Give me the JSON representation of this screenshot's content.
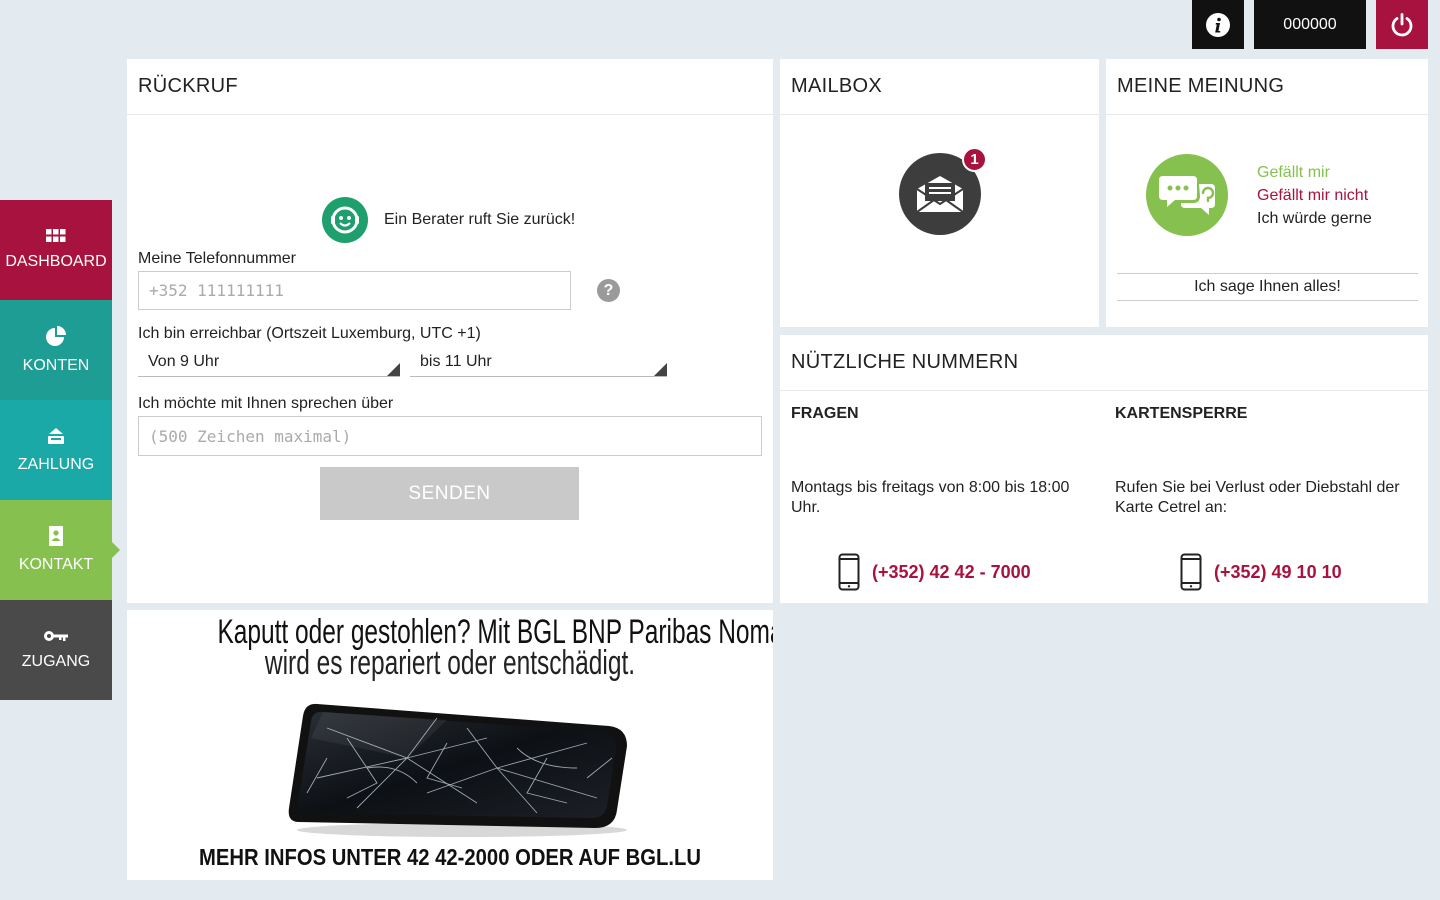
{
  "topbar": {
    "account_number": "000000"
  },
  "sidebar": {
    "items": [
      {
        "label": "DASHBOARD",
        "icon": "grid-icon",
        "color": "#a8123e"
      },
      {
        "label": "KONTEN",
        "icon": "pie-chart-icon",
        "color": "#1d9d94"
      },
      {
        "label": "ZAHLUNG",
        "icon": "payment-icon",
        "color": "#1aa9a6"
      },
      {
        "label": "KONTAKT",
        "icon": "contact-book-icon",
        "color": "#86c04e",
        "active": true
      },
      {
        "label": "ZUGANG",
        "icon": "key-icon",
        "color": "#4a4a4a"
      }
    ]
  },
  "rueckruf": {
    "title": "RÜCKRUF",
    "advisor_text": "Ein Berater ruft Sie zurück!",
    "phone_label": "Meine Telefonnummer",
    "phone_placeholder": "+352 111111111",
    "reachable_label": "Ich bin erreichbar (Ortszeit Luxemburg, UTC +1)",
    "from_select": "Von 9 Uhr",
    "to_select": "bis 11 Uhr",
    "topic_label": "Ich möchte mit Ihnen sprechen über",
    "topic_placeholder": "(500 Zeichen maximal)",
    "send_label": "SENDEN"
  },
  "mailbox": {
    "title": "MAILBOX",
    "unread_count": "1"
  },
  "meinung": {
    "title": "MEINE MEINUNG",
    "like": "Gefällt mir",
    "dislike": "Gefällt mir nicht",
    "wish": "Ich würde gerne",
    "tell_all": "Ich sage Ihnen alles!"
  },
  "nummern": {
    "title": "NÜTZLICHE NUMMERN",
    "fragen": {
      "title": "FRAGEN",
      "text": "Montags bis freitags von 8:00 bis 18:00 Uhr.",
      "phone": "(+352) 42 42 - 7000"
    },
    "kartensperre": {
      "title": "KARTENSPERRE",
      "text": "Rufen Sie bei Verlust oder Diebstahl der Karte Cetrel an:",
      "phone": "(+352) 49 10 10"
    }
  },
  "ad": {
    "line1_bold": "Kaputt oder gestohlen?",
    "line1_rest": "Mit",
    "line1_brand": "BGL BNP Paribas Nomad",
    "line2": "wird es repariert oder entschädigt.",
    "footer": "MEHR INFOS UNTER 42 42-2000 ODER AUF BGL.LU"
  }
}
